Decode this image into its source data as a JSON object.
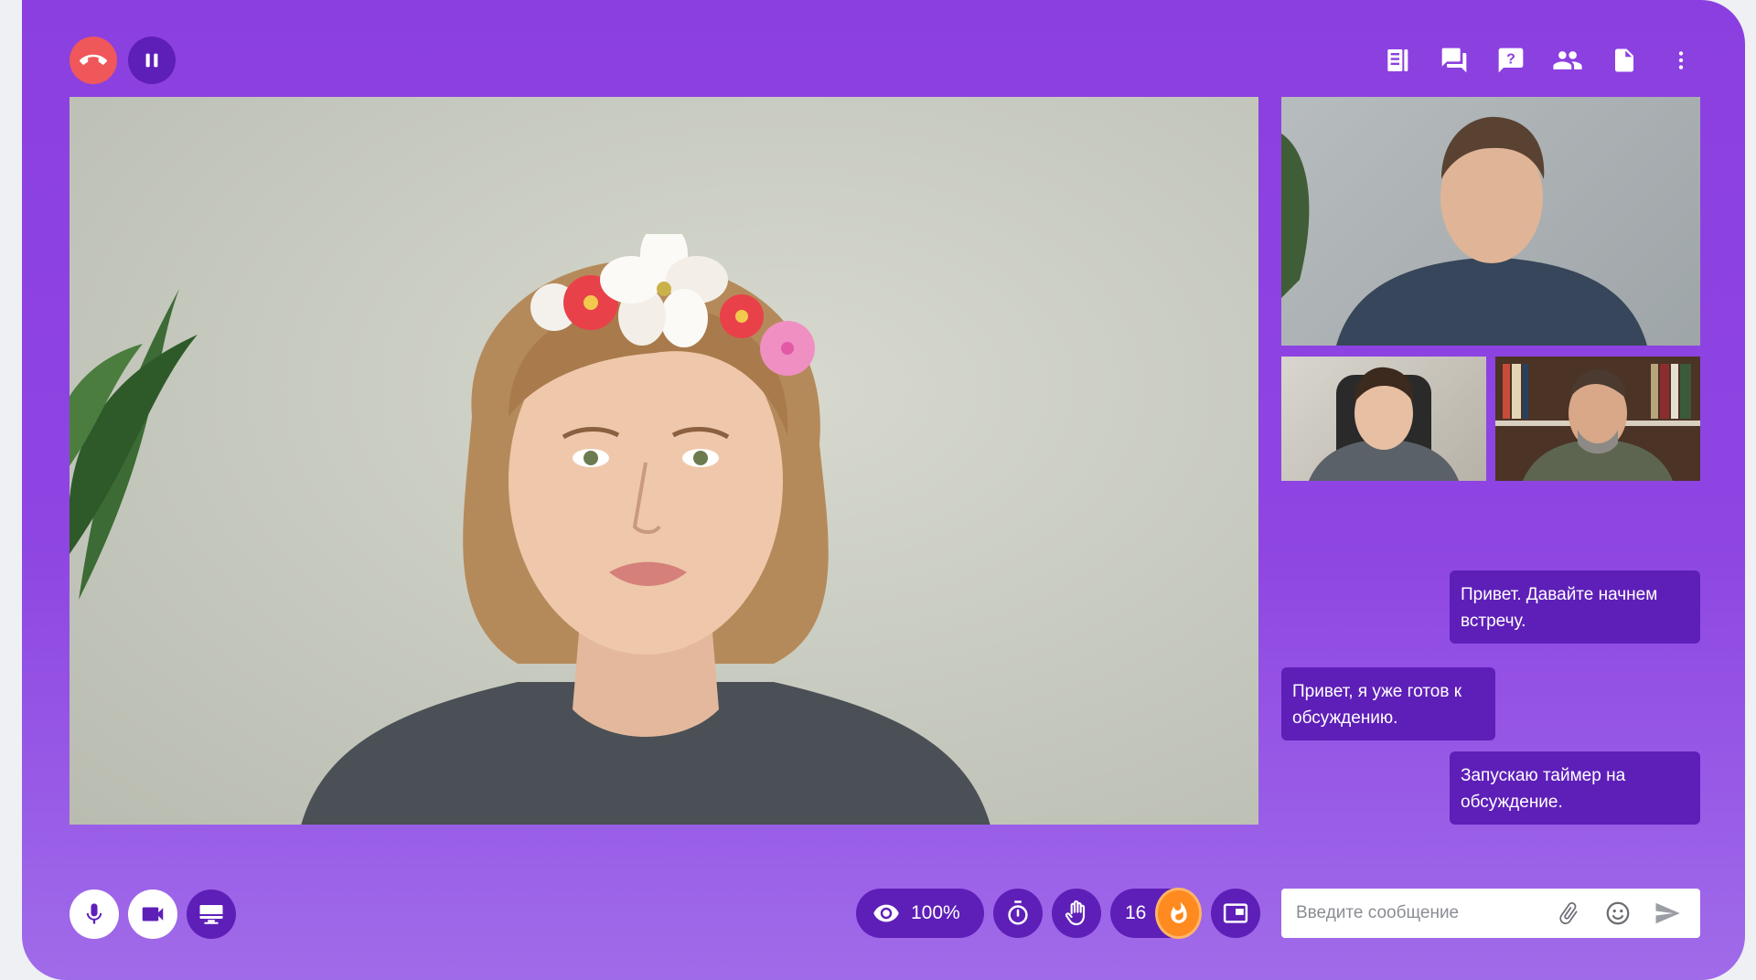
{
  "toolbar_top": {
    "icons": [
      "end-call-icon",
      "pause-icon",
      "notes-icon",
      "chat-icon",
      "question-icon",
      "participants-icon",
      "document-icon",
      "more-vertical-icon"
    ]
  },
  "chat": {
    "messages": [
      {
        "side": "right",
        "text": "Привет. Давайте начнем встречу."
      },
      {
        "side": "left",
        "text": "Привет, я уже готов к обсуждению."
      },
      {
        "side": "right",
        "text": "Запускаю таймер на обсуждение."
      }
    ],
    "input_placeholder": "Введите сообщение"
  },
  "controls": {
    "visibility_percent": "100%",
    "reactions_count": "16"
  },
  "colors": {
    "background": "#8b3fe0",
    "dark_purple": "#5e1fb8",
    "end_call": "#f0575a",
    "fire": "#ff8a1f"
  }
}
